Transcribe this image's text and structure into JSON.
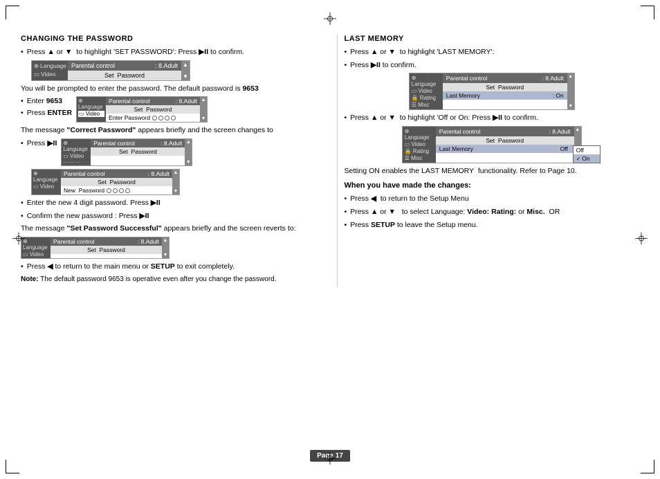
{
  "page": {
    "number": "Page 17",
    "corners": [
      "tl",
      "tr",
      "bl",
      "br"
    ]
  },
  "left_section": {
    "title": "CHANGING THE PASSWORD",
    "bullet1": "Press ▲ or ▼  to highlight 'SET PASSWORD': Press ▶II to confirm.",
    "menu1": {
      "icon_items": [
        "Language",
        "Video"
      ],
      "selected_icon": "Language",
      "header_label": "Parental control",
      "header_value": ": 8.Adult",
      "sub_label": "Set  Password"
    },
    "para1": "You will be prompted to enter the password. The default password is 9653",
    "enter_label": "Enter 9653",
    "press_enter_label": "Press ENTER",
    "menu2": {
      "icon_items": [
        "Language",
        "Video"
      ],
      "selected_icon": "Language",
      "header_label": "Parental control",
      "header_value": ": 8.Adult",
      "sub_label": "Set  Password",
      "item_label": "Enter Password"
    },
    "para2": "The message \"Correct Password\" appears briefly and the screen changes to",
    "bullet_press1": "Press ▶II",
    "menu3": {
      "icon_items": [
        "Language",
        "Video"
      ],
      "selected_icon": "Language",
      "header_label": "Parental control",
      "header_value": ": 8.Adult",
      "sub_label": "Set  Password"
    },
    "menu4": {
      "icon_items": [
        "Language",
        "Video"
      ],
      "selected_icon": "Language",
      "header_label": "Parental control",
      "header_value": ": 8.Adult",
      "sub_label": "Set  Password",
      "item_label": "New  Password"
    },
    "bullet_new1": "Enter the new 4 digit password. Press ▶II",
    "bullet_new2": "Confirm the new password : Press ▶II",
    "para3": "The message \"Set Password Successful\" appears briefly and the screen reverts to:",
    "menu5": {
      "icon_items": [
        "Language",
        "Video"
      ],
      "selected_icon": "Language",
      "header_label": "Parental control",
      "header_value": ": 8.Adult",
      "sub_label": "Set  Password"
    },
    "bullet_back": "Press ◀ to return to the main menu or SETUP to exit completely.",
    "note": "Note: The default password 9653 is operative even after you change the password."
  },
  "right_section": {
    "title": "LAST MEMORY",
    "bullet1": "Press ▲ or ▼  to highlight 'LAST MEMORY':",
    "bullet2": "Press ▶II to confirm.",
    "menu1": {
      "icon_items": [
        "Language",
        "Video",
        "Rating",
        "Misc"
      ],
      "selected_icon": "Language",
      "header_label": "Parental control",
      "header_value": ": 8.Adult",
      "sub_label": "Set  Password",
      "item_label": "Last Memory",
      "item_value": ": On"
    },
    "bullet3": "Press ▲ or ▼  to highlight 'Off or On: Press ▶II to confirm.",
    "menu2": {
      "icon_items": [
        "Language",
        "Video",
        "Rating",
        "Misc"
      ],
      "selected_icon": "Language",
      "header_label": "Parental control",
      "header_value": ": 8.Adult",
      "sub_label": "Set  Password",
      "item_label": "Last Memory",
      "dropdown_items": [
        "Off",
        "On"
      ],
      "dropdown_selected": "On"
    },
    "para1": "Setting ON enables the LAST MEMORY  functionality. Refer to Page 10.",
    "when_changes": "When you have made the changes:",
    "bullet_back": "Press ◀  to return to the Setup Menu",
    "bullet_select": "Press ▲ or ▼   to select Language: Video: Rating: or Misc.  OR",
    "bullet_setup": "Press SETUP to leave the Setup menu."
  }
}
